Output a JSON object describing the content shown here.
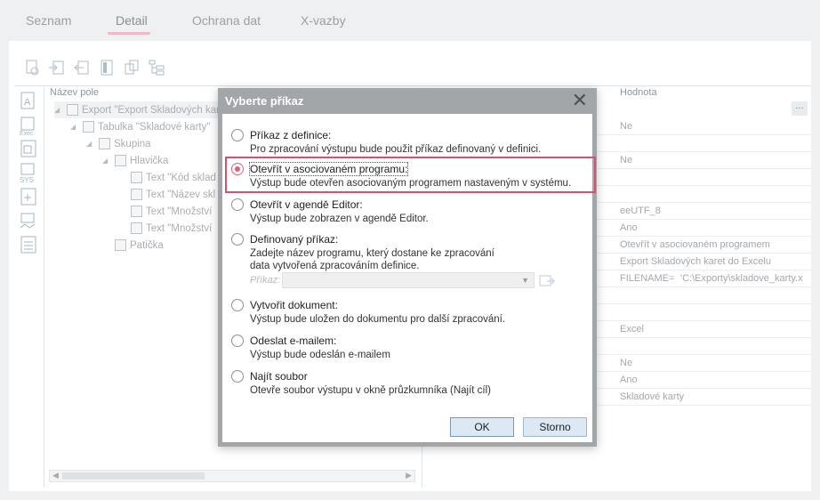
{
  "tabs": [
    {
      "label": "Seznam"
    },
    {
      "label": "Detail"
    },
    {
      "label": "Ochrana dat"
    },
    {
      "label": "X-vazby"
    }
  ],
  "tree": {
    "header": "Název pole",
    "rows": [
      {
        "label": "Export \"Export Skladových karet"
      },
      {
        "label": "Tabulka \"Skladové karty\""
      },
      {
        "label": "Skupina"
      },
      {
        "label": "Hlavička"
      },
      {
        "label": "Text \"Kód sklad"
      },
      {
        "label": "Text \"Název skl"
      },
      {
        "label": "Text \"Množství"
      },
      {
        "label": "Text \"Množství"
      },
      {
        "label": "Patička"
      }
    ]
  },
  "values": {
    "header": "Hodnota",
    "dots": "…",
    "rows": [
      {
        "text": "Ne"
      },
      {
        "text": "Ne"
      },
      {
        "text": "eeUTF_8"
      },
      {
        "text": "Ano"
      },
      {
        "text": "Otevřít v asociovaném programem"
      },
      {
        "text": "Export Skladových karet do Excelu"
      },
      {
        "text": "FILENAME=",
        "text2": "'C:\\Exporty\\skladove_karty.x"
      },
      {
        "text": "Excel"
      },
      {
        "text": "Ne"
      },
      {
        "text": "Ano"
      },
      {
        "text": "Skladové karty"
      }
    ]
  },
  "dialog": {
    "title": "Vyberte příkaz",
    "close": "✕",
    "options": [
      {
        "label": "Příkaz z definice:",
        "desc": "Pro zpracování výstupu bude použit příkaz definovaný v definici.",
        "checked": false
      },
      {
        "label": "Otevřít v asociovaném programu:",
        "desc": "Výstup bude otevřen asociovaným programem nastaveným v systému.",
        "checked": true
      },
      {
        "label": "Otevřít v agendě Editor:",
        "desc": "Výstup bude zobrazen v agendě Editor.",
        "checked": false
      },
      {
        "label": "Definovaný příkaz:",
        "desc": "Zadejte název programu, který dostane ke zpracování",
        "desc2": "data vytvořená zpracováním definice.",
        "checked": false
      },
      {
        "label": "Vytvořit dokument:",
        "desc": "Výstup bude uložen do dokumentu pro další zpracování.",
        "checked": false
      },
      {
        "label": "Odeslat e-mailem:",
        "desc": "Výstup bude odeslán e-mailem",
        "checked": false
      },
      {
        "label": "Najít soubor",
        "desc": "Otevře soubor výstupu v okně průzkumníka (Najít cíl)",
        "checked": false
      }
    ],
    "prikaz_label": "Příkaz:",
    "prikaz_value": "",
    "ok_label": "OK",
    "cancel_label": "Storno"
  }
}
